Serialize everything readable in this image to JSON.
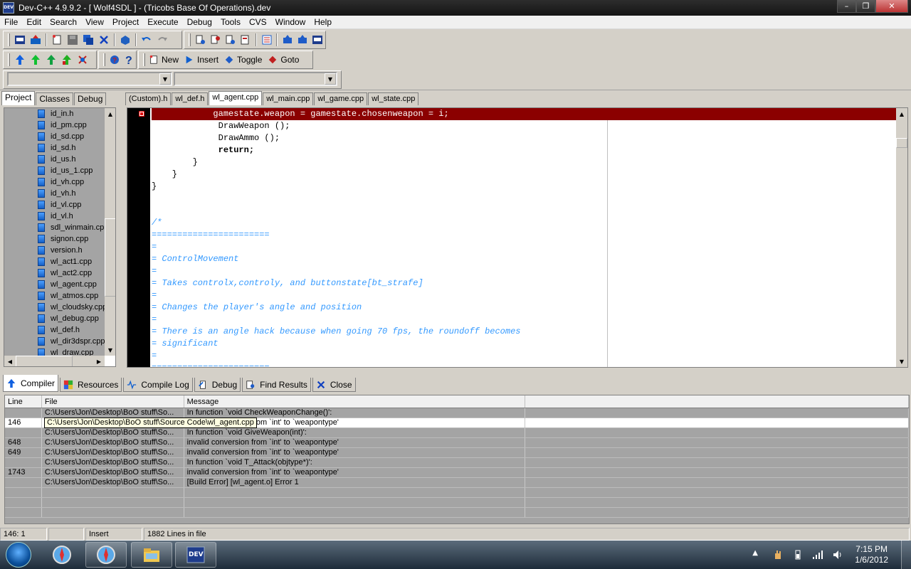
{
  "window": {
    "title": "Dev-C++ 4.9.9.2  - [ Wolf4SDL ] - (Tricobs Base Of Operations).dev",
    "icon_label": "DEV"
  },
  "menu": [
    "File",
    "Edit",
    "Search",
    "View",
    "Project",
    "Execute",
    "Debug",
    "Tools",
    "CVS",
    "Window",
    "Help"
  ],
  "toolbar": {
    "new_label": "New",
    "insert_label": "Insert",
    "toggle_label": "Toggle",
    "goto_label": "Goto"
  },
  "left_tabs": [
    "Project",
    "Classes",
    "Debug"
  ],
  "project_files": [
    "id_in.h",
    "id_pm.cpp",
    "id_sd.cpp",
    "id_sd.h",
    "id_us.h",
    "id_us_1.cpp",
    "id_vh.cpp",
    "id_vh.h",
    "id_vl.cpp",
    "id_vl.h",
    "sdl_winmain.cpp",
    "signon.cpp",
    "version.h",
    "wl_act1.cpp",
    "wl_act2.cpp",
    "wl_agent.cpp",
    "wl_atmos.cpp",
    "wl_cloudsky.cpp",
    "wl_debug.cpp",
    "wl_def.h",
    "wl_dir3dspr.cpp",
    "wl_draw.cpp"
  ],
  "editor_tabs": [
    "(Custom).h",
    "wl_def.h",
    "wl_agent.cpp",
    "wl_main.cpp",
    "wl_game.cpp",
    "wl_state.cpp"
  ],
  "active_editor_tab": "wl_agent.cpp",
  "code_lines": [
    "            gamestate.weapon = gamestate.chosenweapon = i;",
    "             DrawWeapon ();",
    "             DrawAmmo ();",
    "             return;",
    "        }",
    "    }",
    "}",
    "",
    "",
    "/*",
    "=======================",
    "=",
    "= ControlMovement",
    "=",
    "= Takes controlx,controly, and buttonstate[bt_strafe]",
    "=",
    "= Changes the player's angle and position",
    "=",
    "= There is an angle hack because when going 70 fps, the roundoff becomes",
    "= significant",
    "=",
    "======================="
  ],
  "bottom_tabs": [
    "Compiler",
    "Resources",
    "Compile Log",
    "Debug",
    "Find Results",
    "Close"
  ],
  "messages": {
    "headers": [
      "Line",
      "File",
      "Message"
    ],
    "rows": [
      {
        "line": "",
        "file": "C:\\Users\\Jon\\Desktop\\BoO stuff\\So...",
        "message": "In function `void CheckWeaponChange()':"
      },
      {
        "line": "146",
        "file": "C:\\Users\\Jon\\Desktop\\BoO stuff\\So...",
        "message": "invalid conversion from `int' to `weapontype'"
      },
      {
        "line": "",
        "file": "C:\\Users\\Jon\\Desktop\\BoO stuff\\So...",
        "message": "In function `void GiveWeapon(int)':"
      },
      {
        "line": "648",
        "file": "C:\\Users\\Jon\\Desktop\\BoO stuff\\So...",
        "message": "invalid conversion from `int' to `weapontype'"
      },
      {
        "line": "649",
        "file": "C:\\Users\\Jon\\Desktop\\BoO stuff\\So...",
        "message": "invalid conversion from `int' to `weapontype'"
      },
      {
        "line": "",
        "file": "C:\\Users\\Jon\\Desktop\\BoO stuff\\So...",
        "message": "In function `void T_Attack(objtype*)':"
      },
      {
        "line": "1743",
        "file": "C:\\Users\\Jon\\Desktop\\BoO stuff\\So...",
        "message": "invalid conversion from `int' to `weapontype'"
      },
      {
        "line": "",
        "file": "C:\\Users\\Jon\\Desktop\\BoO stuff\\So...",
        "message": "[Build Error]  [wl_agent.o] Error 1"
      }
    ],
    "tooltip": "C:\\Users\\Jon\\Desktop\\BoO stuff\\Source Code\\wl_agent.cpp"
  },
  "status": {
    "position": "146: 1",
    "mode": "Insert",
    "lines": "1882 Lines in file"
  },
  "clock": {
    "time": "7:15 PM",
    "date": "1/6/2012"
  }
}
